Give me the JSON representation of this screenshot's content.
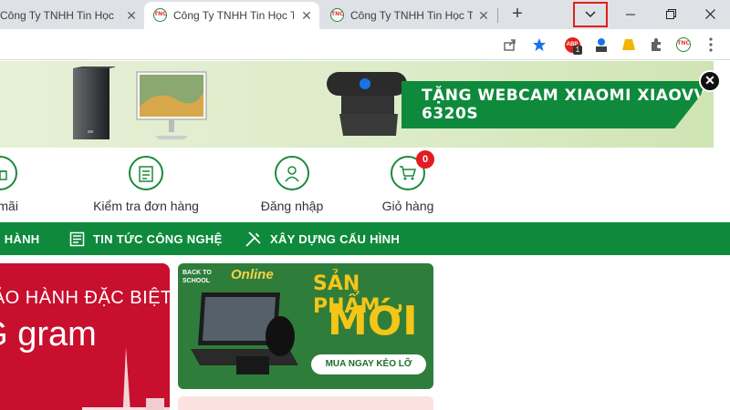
{
  "browser": {
    "tabs": [
      {
        "title": "Công Ty TNHH Tin Học Th",
        "active": false
      },
      {
        "title": "Công Ty TNHH Tin Học Th",
        "active": true
      },
      {
        "title": "Công Ty TNHH Tin Học Th",
        "active": false
      }
    ],
    "favicon_text": "TNC",
    "extension_badge": "1",
    "extension_label": "ABP"
  },
  "page": {
    "banner": {
      "headline": "TẶNG WEBCAM XIAOMI XIAOVV 6320S"
    },
    "icon_nav": [
      {
        "label": "Khuyến mãi"
      },
      {
        "label": "Kiểm tra đơn hàng"
      },
      {
        "label": "Đăng nhập"
      },
      {
        "label": "Giỏ hàng",
        "badge": "0"
      }
    ],
    "main_nav": [
      {
        "label": "BẢO HÀNH"
      },
      {
        "label": "TIN TỨC CÔNG NGHỆ"
      },
      {
        "label": "XÂY DỰNG CẤU HÌNH"
      }
    ],
    "promo_left": {
      "line1": "BẢO HÀNH ĐẶC BIỆT",
      "line2": "LG gram"
    },
    "promo_right": {
      "tag1": "BACK TO SCHOOL",
      "tag2": "Online",
      "title1": "SẢN PHẨM",
      "title2": "MỚI",
      "cta": "MUA NGAY KẺO LỠ"
    }
  },
  "colors": {
    "brand_green": "#0f8a3c",
    "highlight_red": "#e0201b",
    "promo_red": "#c8102e"
  }
}
